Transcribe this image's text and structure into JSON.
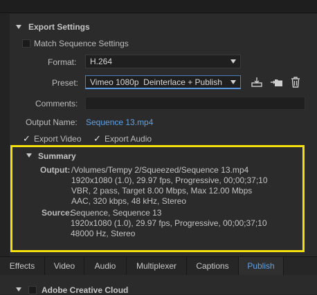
{
  "export_settings": {
    "section_title": "Export Settings",
    "match_sequence_label": "Match Sequence Settings",
    "format_label": "Format:",
    "format_value": "H.264",
    "preset_label": "Preset:",
    "preset_value": "Vimeo 1080p  Deinterlace + Publish",
    "comments_label": "Comments:",
    "output_name_label": "Output Name:",
    "output_name_value": "Sequence 13.mp4",
    "export_video_label": "Export Video",
    "export_audio_label": "Export Audio",
    "export_video_checked": true,
    "export_audio_checked": true,
    "match_sequence_checked": false
  },
  "summary": {
    "title": "Summary",
    "output_label": "Output:",
    "output_lines": [
      "/Volumes/Tempy 2/Squeezed/Sequence 13.mp4",
      "1920x1080 (1.0), 29.97 fps, Progressive, 00;00;37;10",
      "VBR, 2 pass, Target 8.00 Mbps, Max 12.00 Mbps",
      "AAC, 320 kbps, 48 kHz, Stereo"
    ],
    "source_label": "Source:",
    "source_lines": [
      "Sequence, Sequence 13",
      "1920x1080 (1.0), 29.97 fps, Progressive, 00;00;37;10",
      "48000 Hz, Stereo"
    ]
  },
  "tabs": [
    {
      "label": "Effects",
      "active": false
    },
    {
      "label": "Video",
      "active": false
    },
    {
      "label": "Audio",
      "active": false
    },
    {
      "label": "Multiplexer",
      "active": false
    },
    {
      "label": "Captions",
      "active": false
    },
    {
      "label": "Publish",
      "active": true
    }
  ],
  "bottom_section": {
    "title": "Adobe Creative Cloud"
  },
  "icons": {
    "save_preset": "save-preset-icon",
    "import_preset": "import-preset-icon",
    "delete_preset": "trash-icon"
  },
  "colors": {
    "highlight": "#f6e00c",
    "link": "#5fa1e6"
  }
}
